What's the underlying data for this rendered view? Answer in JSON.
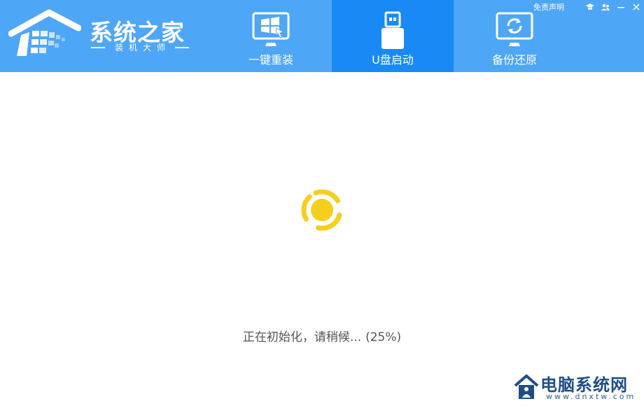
{
  "brand": {
    "title": "系统之家",
    "subtitle": "装机大师"
  },
  "nav": {
    "tabs": [
      {
        "label": "一键重装",
        "icon": "windows-monitor-icon",
        "active": false
      },
      {
        "label": "U盘启动",
        "icon": "usb-drive-icon",
        "active": true
      },
      {
        "label": "备份还原",
        "icon": "backup-restore-icon",
        "active": false
      }
    ]
  },
  "window": {
    "disclaimer": "免责声明",
    "buttons": [
      "graduation-cap-icon",
      "users-icon",
      "minimize-icon",
      "close-icon"
    ]
  },
  "status": {
    "text": "正在初始化，请稍候...",
    "progress": "(25%)"
  },
  "watermark": {
    "title": "电脑系统网",
    "url": "www.dnxtw.com"
  },
  "colors": {
    "header": "#4ea6f7",
    "active_tab": "#1989f6",
    "spinner": "#f5cf1d",
    "status_text": "#555555",
    "watermark": "#1f4e86"
  }
}
